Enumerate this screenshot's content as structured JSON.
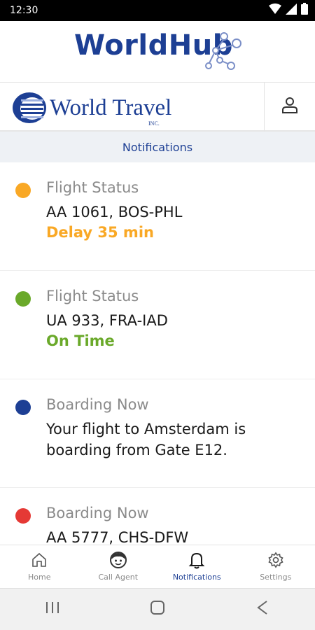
{
  "status_bar": {
    "time": "12:30",
    "icons": [
      "wifi-icon",
      "signal-icon",
      "battery-icon"
    ]
  },
  "app": {
    "title": "WorldHub",
    "icon": "network-icon",
    "brand_color": "#1d3f94"
  },
  "brand": {
    "name": "World Travel",
    "suffix": "INC.",
    "logo_icon": "globe-logo-icon"
  },
  "section": {
    "title": "Notifications"
  },
  "notifications": [
    {
      "title": "Flight Status",
      "body": "AA 1061, BOS-PHL",
      "status": "Delay 35 min",
      "dot_color": "#f9a825",
      "status_color": "#f9a825"
    },
    {
      "title": "Flight Status",
      "body": "UA 933, FRA-IAD",
      "status": "On Time",
      "dot_color": "#6aa92a",
      "status_color": "#6aa92a"
    },
    {
      "title": "Boarding Now",
      "body": "Your flight to Amsterdam is boarding from Gate E12.",
      "status": "",
      "dot_color": "#1d3f94",
      "status_color": "#1d3f94"
    },
    {
      "title": "Boarding Now",
      "body": "AA 5777, CHS-DFW",
      "status": "",
      "dot_color": "#e53935",
      "status_color": "#e53935"
    }
  ],
  "bottom_nav": [
    {
      "label": "Home",
      "icon": "home-icon",
      "active": false
    },
    {
      "label": "Call Agent",
      "icon": "agent-icon",
      "active": false
    },
    {
      "label": "Notifications",
      "icon": "bell-icon",
      "active": true
    },
    {
      "label": "Settings",
      "icon": "gear-icon",
      "active": false
    }
  ],
  "system_nav": [
    "recents-icon",
    "home-circle-icon",
    "back-icon"
  ]
}
